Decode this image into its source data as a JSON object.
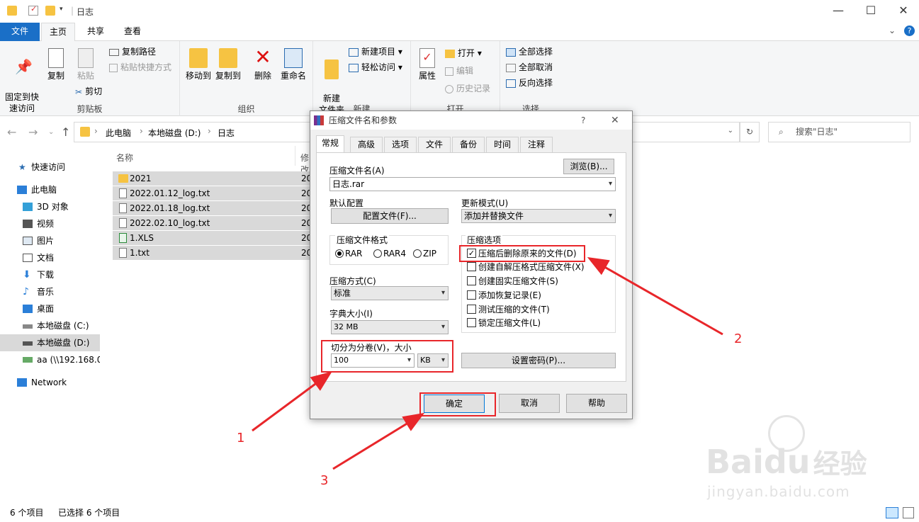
{
  "window": {
    "title": "日志"
  },
  "tabs": [
    {
      "label": "文件"
    },
    {
      "label": "主页"
    },
    {
      "label": "共享"
    },
    {
      "label": "查看"
    }
  ],
  "ribbon": {
    "clipboard": {
      "pin": "固定到快\n速访问",
      "copy": "复制",
      "paste": "粘贴",
      "copy_path": "复制路径",
      "paste_shortcut": "粘贴快捷方式",
      "cut": "剪切",
      "label": "剪贴板"
    },
    "organize": {
      "move_to": "移动到",
      "copy_to": "复制到",
      "delete": "删除",
      "rename": "重命名",
      "label": "组织"
    },
    "new": {
      "new_folder": "新建\n文件夹",
      "new_item": "新建项目",
      "easy_access": "轻松访问",
      "label": "新建"
    },
    "open": {
      "properties": "属性",
      "open": "打开",
      "edit": "编辑",
      "history": "历史记录",
      "label": "打开"
    },
    "select": {
      "select_all": "全部选择",
      "select_none": "全部取消",
      "invert": "反向选择",
      "label": "选择"
    }
  },
  "address": {
    "crumbs": [
      "此电脑",
      "本地磁盘 (D:)",
      "日志"
    ],
    "search_placeholder": "搜索\"日志\""
  },
  "nav": [
    {
      "label": "快速访问"
    },
    {
      "label": "此电脑"
    },
    {
      "label": "3D 对象"
    },
    {
      "label": "视频"
    },
    {
      "label": "图片"
    },
    {
      "label": "文档"
    },
    {
      "label": "下载"
    },
    {
      "label": "音乐"
    },
    {
      "label": "桌面"
    },
    {
      "label": "本地磁盘 (C:)"
    },
    {
      "label": "本地磁盘 (D:)"
    },
    {
      "label": "aa (\\\\192.168.0"
    },
    {
      "label": "Network"
    }
  ],
  "file_list": {
    "col_name": "名称",
    "col_modified": "修改",
    "rows": [
      {
        "name": "2021",
        "date": "20"
      },
      {
        "name": "2022.01.12_log.txt",
        "date": "20"
      },
      {
        "name": "2022.01.18_log.txt",
        "date": "20"
      },
      {
        "name": "2022.02.10_log.txt",
        "date": "20"
      },
      {
        "name": "1.XLS",
        "date": "20"
      },
      {
        "name": "1.txt",
        "date": "20"
      }
    ]
  },
  "status": {
    "count": "6 个项目",
    "selected": "已选择 6 个项目"
  },
  "dialog": {
    "title": "压缩文件名和参数",
    "help_mark": "?",
    "tabs": [
      "常规",
      "高级",
      "选项",
      "文件",
      "备份",
      "时间",
      "注释"
    ],
    "archive_name_label": "压缩文件名(A)",
    "browse": "浏览(B)...",
    "archive_name": "日志.rar",
    "default_profile_label": "默认配置",
    "profile_button": "配置文件(F)...",
    "update_mode_label": "更新模式(U)",
    "update_mode": "添加并替换文件",
    "format_label": "压缩文件格式",
    "formats": [
      "RAR",
      "RAR4",
      "ZIP"
    ],
    "options_label": "压缩选项",
    "options": [
      {
        "label": "压缩后删除原来的文件(D)",
        "checked": true
      },
      {
        "label": "创建自解压格式压缩文件(X)",
        "checked": false
      },
      {
        "label": "创建固实压缩文件(S)",
        "checked": false
      },
      {
        "label": "添加恢复记录(E)",
        "checked": false
      },
      {
        "label": "测试压缩的文件(T)",
        "checked": false
      },
      {
        "label": "锁定压缩文件(L)",
        "checked": false
      }
    ],
    "method_label": "压缩方式(C)",
    "method": "标准",
    "dict_label": "字典大小(I)",
    "dict": "32 MB",
    "split_label": "切分为分卷(V)，大小",
    "split_value": "100",
    "split_unit": "KB",
    "password_button": "设置密码(P)...",
    "ok": "确定",
    "cancel": "取消",
    "help": "帮助"
  },
  "annotations": [
    "1",
    "2",
    "3"
  ],
  "watermark": {
    "brand": "Bai",
    "brand2": "du",
    "cn": "经验",
    "url": "jingyan.baidu.com"
  }
}
